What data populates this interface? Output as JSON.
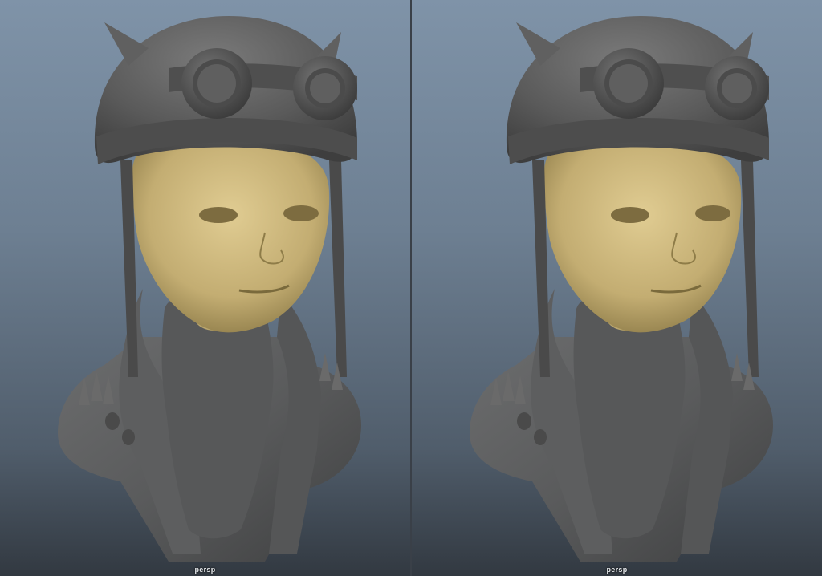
{
  "viewports": {
    "left": {
      "camera_label": "persp",
      "shading": "smooth-shaded"
    },
    "right": {
      "camera_label": "persp",
      "shading": "wireframe-on-shaded"
    }
  },
  "colors": {
    "background_top": "#7f93a8",
    "background_bottom": "#323941",
    "helmet_gray": "#5b5b5b",
    "skin": "#c9b47c",
    "jacket_gray": "#5e5f60",
    "wireframe": "#2c2fd0"
  }
}
